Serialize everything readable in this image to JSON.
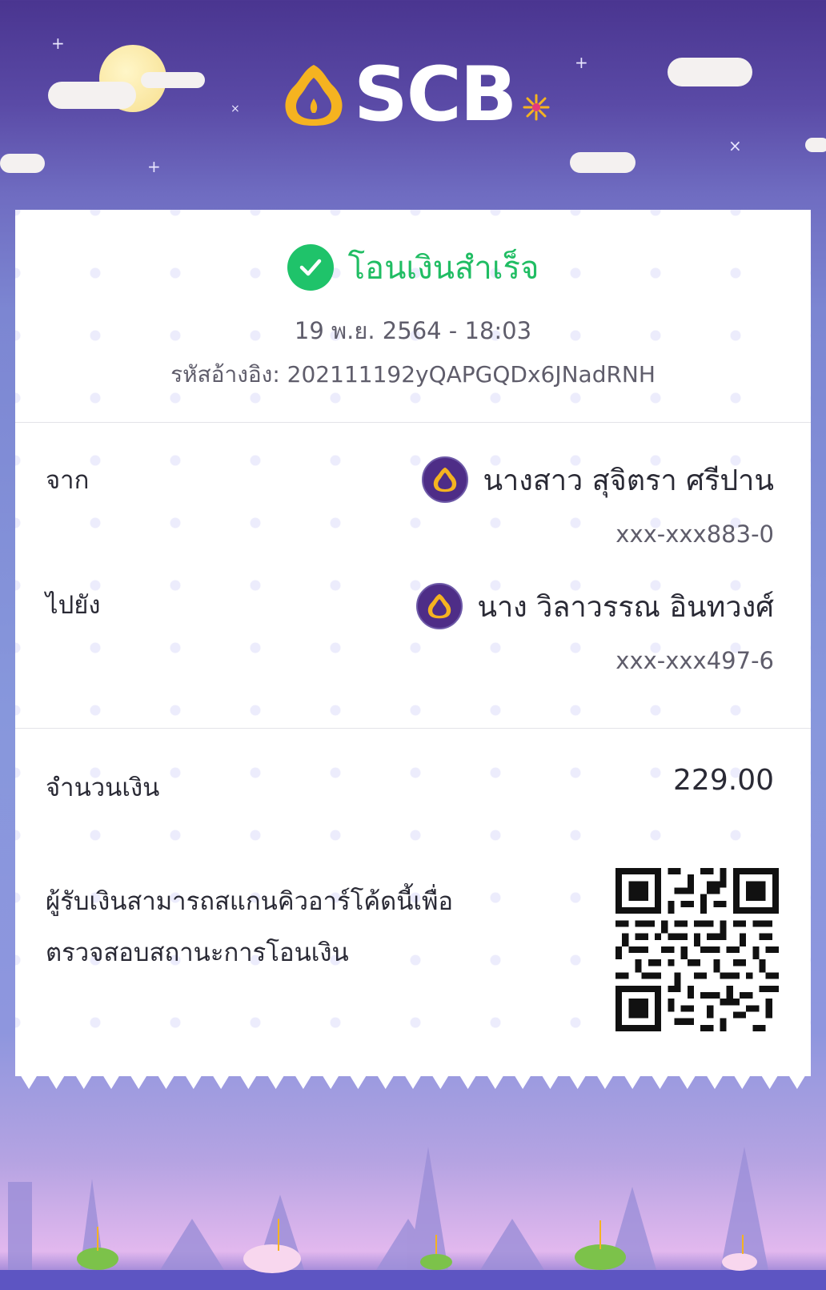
{
  "brand": {
    "name": "SCB"
  },
  "status": {
    "title": "โอนเงินสำเร็จ",
    "icon": "check-circle-icon",
    "color": "#1fc36a"
  },
  "transaction": {
    "datetime": "19 พ.ย. 2564 - 18:03",
    "reference": "รหัสอ้างอิง: 202111192yQAPGQDx6JNadRNH"
  },
  "from": {
    "label": "จาก",
    "name": "นางสาว สุจิตรา ศรีปาน",
    "account": "xxx-xxx883-0",
    "bank_icon": "scb-bank-icon"
  },
  "to": {
    "label": "ไปยัง",
    "name": "นาง วิลาวรรณ อินทวงศ์",
    "account": "xxx-xxx497-6",
    "bank_icon": "scb-bank-icon"
  },
  "amount": {
    "label": "จำนวนเงิน",
    "value": "229.00"
  },
  "qr_note": {
    "line1": "ผู้รับเงินสามารถสแกนคิวอาร์โค้ดนี้เพื่อ",
    "line2": "ตรวจสอบสถานะการโอนเงิน"
  },
  "colors": {
    "accent": "#4e2d87",
    "gold": "#f5b320",
    "success": "#20bd63"
  }
}
